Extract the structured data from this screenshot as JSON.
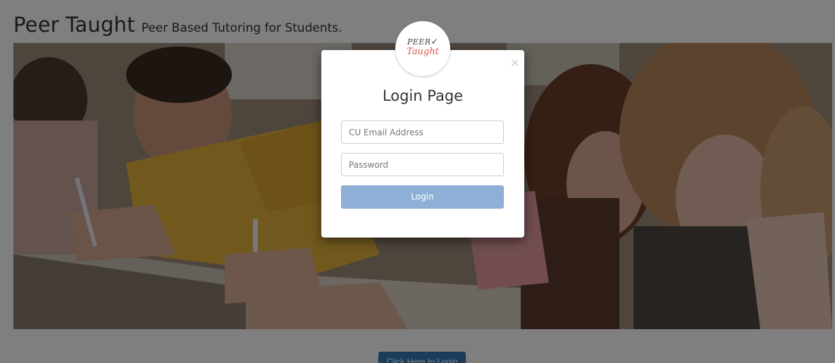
{
  "header": {
    "brand": "Peer Taught",
    "tagline": "Peer Based Tutoring for Students."
  },
  "hero": {
    "image": "students-writing-exam-photo"
  },
  "page_button": {
    "label": "Click Here to Login"
  },
  "modal": {
    "logo": {
      "line1": "PEER",
      "check": "✓",
      "line2": "Taught"
    },
    "close_label": "×",
    "title": "Login Page",
    "email": {
      "placeholder": "CU Email Address",
      "value": ""
    },
    "password": {
      "placeholder": "Password",
      "value": ""
    },
    "login_label": "Login"
  },
  "colors": {
    "primary_button": "#337ab7",
    "login_button": "#8fb0d6",
    "logo_accent": "#d9534f"
  }
}
